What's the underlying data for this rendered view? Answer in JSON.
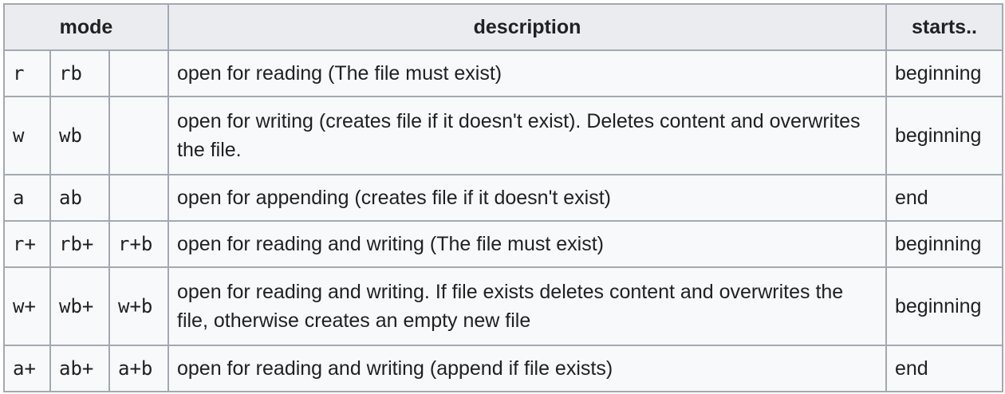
{
  "table": {
    "headers": {
      "mode": "mode",
      "description": "description",
      "starts": "starts.."
    },
    "rows": [
      {
        "mode_text": "r",
        "mode_binary": "rb",
        "mode_binary_alt": "",
        "description": "open for reading (The file must exist)",
        "starts": "beginning"
      },
      {
        "mode_text": "w",
        "mode_binary": "wb",
        "mode_binary_alt": "",
        "description": "open for writing (creates file if it doesn't exist). Deletes content and overwrites the file.",
        "starts": "beginning"
      },
      {
        "mode_text": "a",
        "mode_binary": "ab",
        "mode_binary_alt": "",
        "description": "open for appending (creates file if it doesn't exist)",
        "starts": "end"
      },
      {
        "mode_text": "r+",
        "mode_binary": "rb+",
        "mode_binary_alt": "r+b",
        "description": "open for reading and writing (The file must exist)",
        "starts": "beginning"
      },
      {
        "mode_text": "w+",
        "mode_binary": "wb+",
        "mode_binary_alt": "w+b",
        "description": "open for reading and writing. If file exists deletes content and overwrites the file, otherwise creates an empty new file",
        "starts": "beginning"
      },
      {
        "mode_text": "a+",
        "mode_binary": "ab+",
        "mode_binary_alt": "a+b",
        "description": "open for reading and writing (append if file exists)",
        "starts": "end"
      }
    ]
  }
}
